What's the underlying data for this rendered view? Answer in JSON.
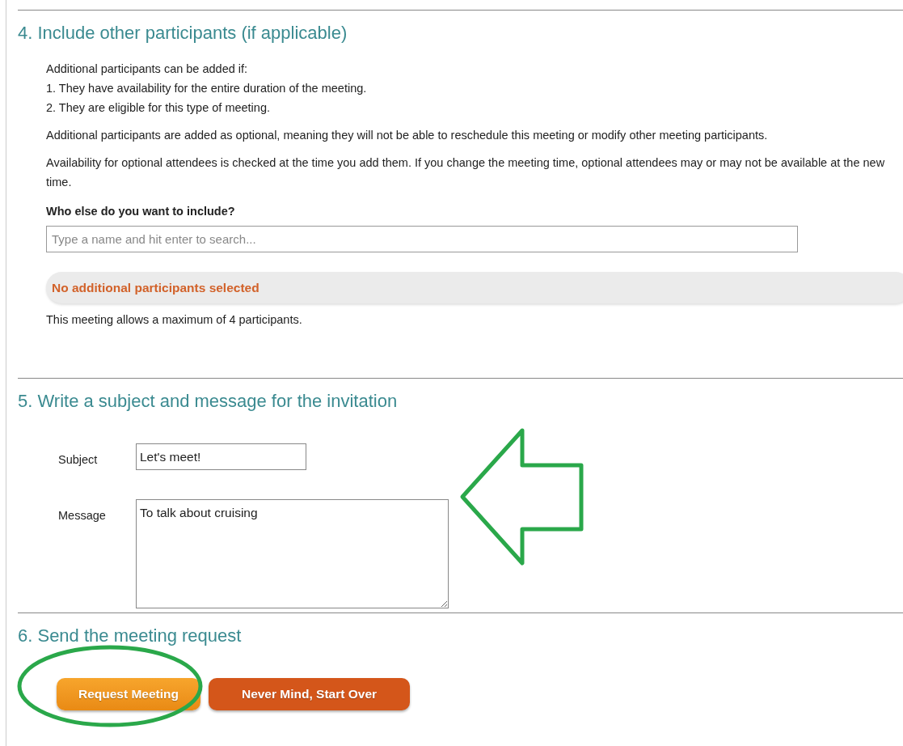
{
  "sections": [
    {
      "heading": "4. Include other participants (if applicable)",
      "kind": "participants",
      "paragraphs": [
        [
          "Additional participants can be added if:",
          "1. They have availability for the entire duration of the meeting.",
          "2. They are eligible for this type of meeting."
        ],
        [
          "Additional participants are added as optional, meaning they will not be able to reschedule this meeting or modify other meeting participants."
        ],
        [
          "Availability for optional attendees is checked at the time you add them. If you change the meeting time, optional attendees may or may not be available at the new time."
        ]
      ],
      "question": "Who else do you want to include?",
      "search": {
        "placeholder": "Type a name and hit enter to search..."
      },
      "notice": "No additional participants selected",
      "limit_note": "This meeting allows a maximum of 4 participants."
    },
    {
      "heading": "5. Write a subject and message for the invitation",
      "kind": "message",
      "fields": [
        {
          "label": "Subject",
          "value": "Let's meet!",
          "kind": "line"
        },
        {
          "label": "Message",
          "value": "To talk about cruising",
          "kind": "area"
        }
      ]
    },
    {
      "heading": "6. Send the meeting request",
      "kind": "actions",
      "buttons": [
        {
          "label": "Request Meeting",
          "kind": "primary"
        },
        {
          "label": "Never Mind, Start Over",
          "kind": "danger"
        }
      ]
    }
  ]
}
